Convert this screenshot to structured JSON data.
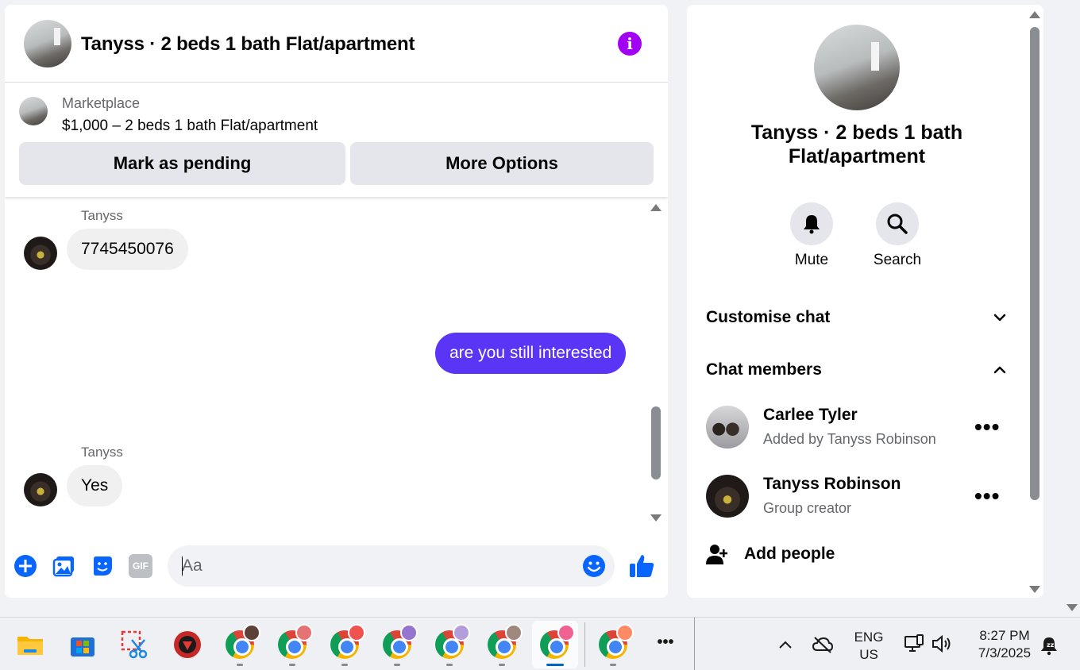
{
  "chat": {
    "title": "Tanyss · 2 beds 1 bath Flat/apartment",
    "marketplace_label": "Marketplace",
    "listing": "$1,000 – 2 beds 1 bath Flat/apartment",
    "mark_pending": "Mark as pending",
    "more_options": "More Options",
    "messages": [
      {
        "sender": "Tanyss",
        "text": "7745450076",
        "direction": "in"
      },
      {
        "sender": "",
        "text": "are you still interested",
        "direction": "out"
      },
      {
        "sender": "Tanyss",
        "text": "Yes",
        "direction": "in"
      }
    ],
    "composer_placeholder": "Aa",
    "gif_label": "GIF"
  },
  "info": {
    "title": "Tanyss · 2 beds 1 bath Flat/apartment",
    "mute_label": "Mute",
    "search_label": "Search",
    "customise_label": "Customise chat",
    "members_label": "Chat members",
    "members": [
      {
        "name": "Carlee Tyler",
        "sub": "Added by Tanyss Robinson"
      },
      {
        "name": "Tanyss Robinson",
        "sub": "Group creator"
      }
    ],
    "more_dots": "•••",
    "add_people": "Add people"
  },
  "taskbar": {
    "lang_top": "ENG",
    "lang_bottom": "US",
    "time": "8:27 PM",
    "date": "7/3/2025",
    "overflow": "•••"
  },
  "colors": {
    "accent_purple": "#a200f5",
    "outgoing_bubble": "#5b35f5",
    "messenger_blue": "#0866ff"
  }
}
